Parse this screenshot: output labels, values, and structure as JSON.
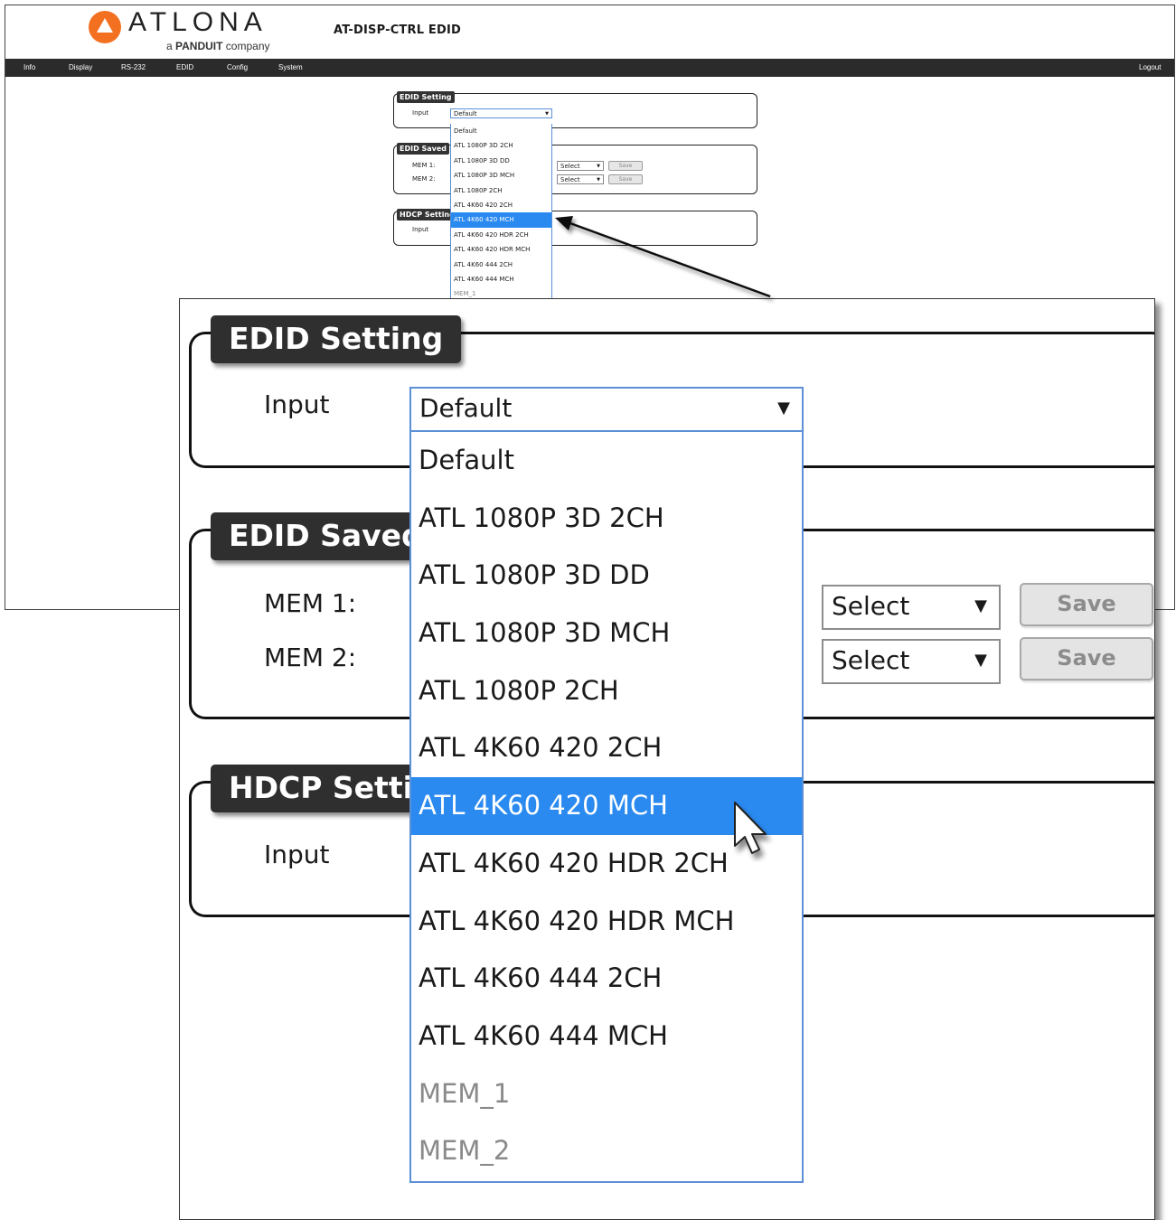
{
  "app": {
    "logo_text": "ATLONA",
    "logo_sub_a": "a ",
    "logo_sub_brand": "PANDUIT",
    "logo_sub_b": " company",
    "page_title": "AT-DISP-CTRL  EDID"
  },
  "nav": {
    "items": [
      "Info",
      "Display",
      "RS-232",
      "EDID",
      "Config",
      "System"
    ],
    "logout": "Logout"
  },
  "edid_setting": {
    "legend": "EDID Setting",
    "input_label": "Input",
    "input_value": "Default"
  },
  "edid_saved": {
    "legend": "EDID Saved",
    "mem1_label": "MEM 1:",
    "mem2_label": "MEM 2:",
    "select1_value": "Select",
    "select2_value": "Select",
    "save1_label": "Save",
    "save2_label": "Save"
  },
  "hdcp_setting": {
    "legend": "HDCP Setting",
    "input_label": "Input"
  },
  "dropdown": {
    "options": [
      "Default",
      "ATL 1080P 3D 2CH",
      "ATL 1080P 3D DD",
      "ATL 1080P 3D MCH",
      "ATL 1080P 2CH",
      "ATL 4K60 420 2CH",
      "ATL 4K60 420 MCH",
      "ATL 4K60 420 HDR 2CH",
      "ATL 4K60 420 HDR MCH",
      "ATL 4K60 444 2CH",
      "ATL 4K60 444 MCH",
      "MEM_1",
      "MEM_2"
    ],
    "highlighted": "ATL 4K60 420 MCH",
    "highlighted_index": 6,
    "disabled": [
      "MEM_1",
      "MEM_2"
    ],
    "arrow_glyph": "▼"
  },
  "colors": {
    "accent": "#2a8af0",
    "nav_bg": "#2b2b2b",
    "legend_bg": "#2f2f2f",
    "logo_orange": "#f37021"
  }
}
